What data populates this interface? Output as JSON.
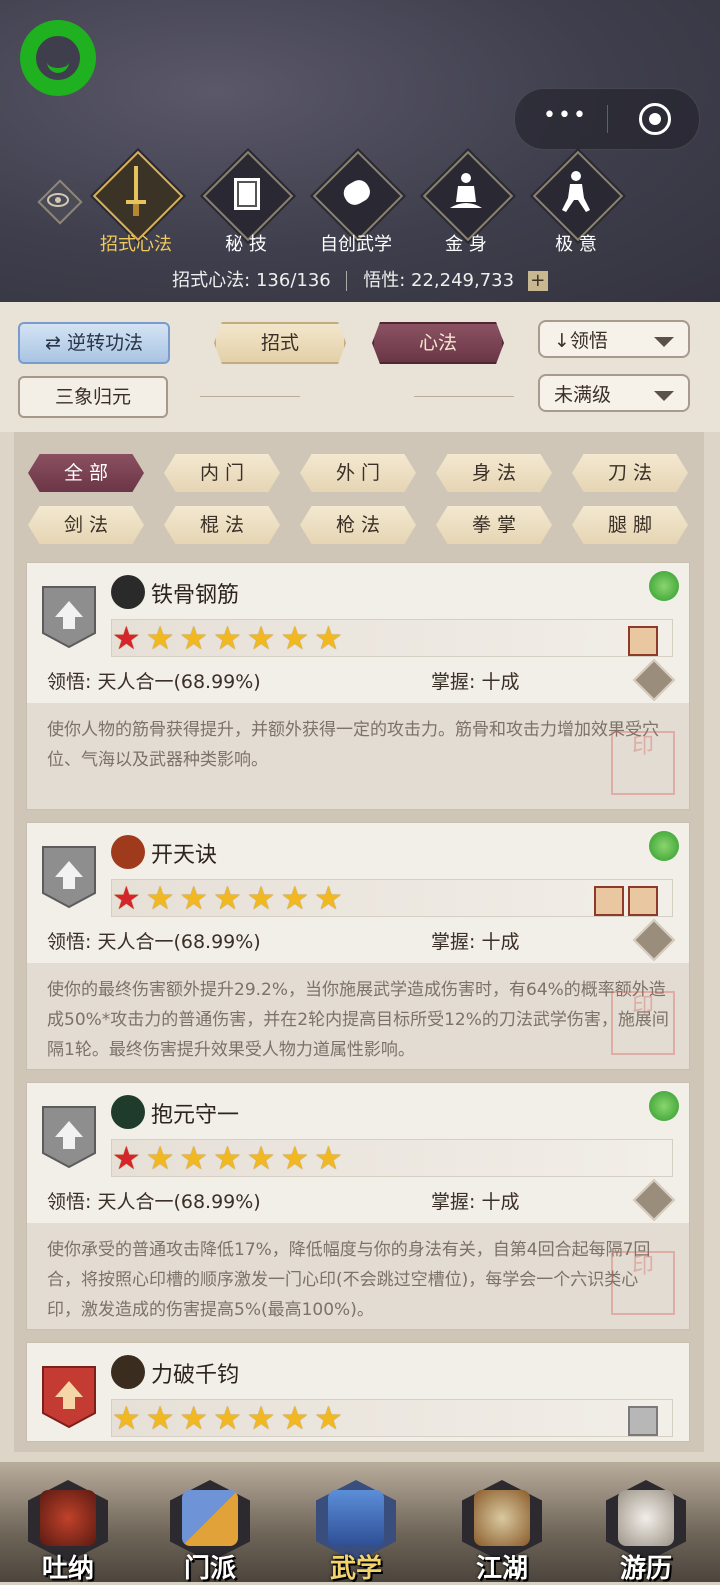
{
  "tabs": [
    {
      "label": "招式心法",
      "icon": "sword-icon",
      "active": true
    },
    {
      "label": "秘 技",
      "icon": "book-icon",
      "active": false
    },
    {
      "label": "自创武学",
      "icon": "scroll-icon",
      "active": false
    },
    {
      "label": "金 身",
      "icon": "meditation-icon",
      "active": false
    },
    {
      "label": "极 意",
      "icon": "fighter-icon",
      "active": false
    }
  ],
  "stats": {
    "moves_label": "招式心法: 136/136",
    "insight_label": "悟性: 22,249,733",
    "plus": "+"
  },
  "controls": {
    "reverse": "逆转功法",
    "moves": "招式",
    "mind": "心法",
    "sort": "领悟",
    "sanxiang": "三象归元",
    "level_filter": "未满级"
  },
  "filters": [
    "全 部",
    "内 门",
    "外 门",
    "身 法",
    "刀 法",
    "剑 法",
    "棍 法",
    "枪 法",
    "拳 掌",
    "腿 脚"
  ],
  "cards": [
    {
      "name": "铁骨钢筋",
      "understand": "领悟:  天人合一(68.99%)",
      "mastery": "掌握:  十成",
      "desc": "使你人物的筋骨获得提升，并额外获得一定的攻击力。筋骨和攻击力增加效果受穴位、气海以及武器种类影响。",
      "first_star_red": true
    },
    {
      "name": "开天诀",
      "understand": "领悟:  天人合一(68.99%)",
      "mastery": "掌握:  十成",
      "desc": "使你的最终伤害额外提升29.2%，当你施展武学造成伤害时，有64%的概率额外造成50%*攻击力的普通伤害，并在2轮内提高目标所受12%的刀法武学伤害，施展间隔1轮。最终伤害提升效果受人物力道属性影响。",
      "first_star_red": true
    },
    {
      "name": "抱元守一",
      "understand": "领悟:  天人合一(68.99%)",
      "mastery": "掌握:  十成",
      "desc": "使你承受的普通攻击降低17%，降低幅度与你的身法有关，自第4回合起每隔7回合，将按照心印槽的顺序激发一门心印(不会跳过空槽位)，每学会一个六识类心印，激发造成的伤害提高5%(最高100%)。",
      "first_star_red": true
    },
    {
      "name": "力破千钧",
      "first_star_red": false
    }
  ],
  "stars": "★★★★★★★",
  "bottom_nav": [
    {
      "label": "吐纳",
      "active": false
    },
    {
      "label": "门派",
      "active": false
    },
    {
      "label": "武学",
      "active": true
    },
    {
      "label": "江湖",
      "active": false
    },
    {
      "label": "游历",
      "active": false
    }
  ],
  "colors": {
    "accent_gold": "#f0c95a",
    "active_maroon": "#6b3647",
    "star": "#f1b821",
    "star_red": "#d4252b"
  }
}
